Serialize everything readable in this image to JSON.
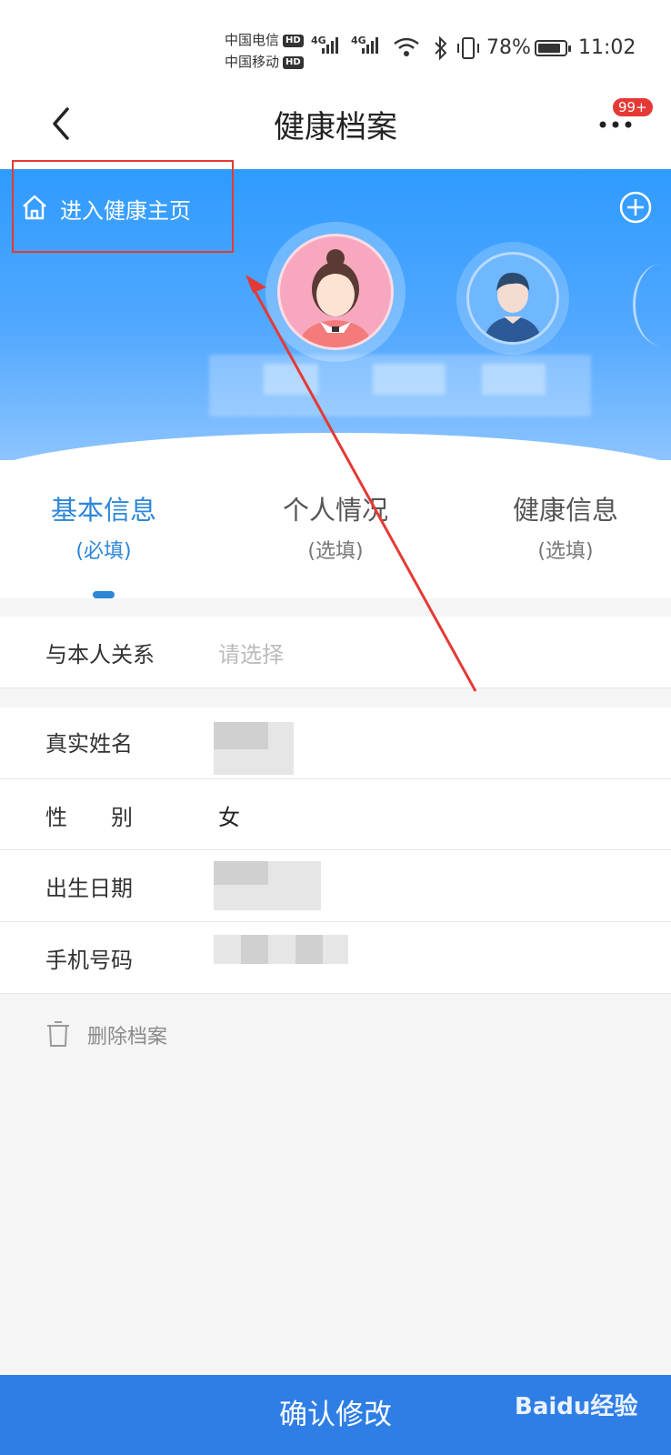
{
  "status_bar": {
    "carrier1": "中国电信",
    "carrier2": "中国移动",
    "hd": "HD",
    "net1": "4G",
    "net2": "4G",
    "battery": "78%",
    "time": "11:02"
  },
  "nav": {
    "title": "健康档案",
    "badge": "99+"
  },
  "banner": {
    "home_label": "进入健康主页"
  },
  "tabs": [
    {
      "label": "基本信息",
      "sub": "(必填)",
      "active": true
    },
    {
      "label": "个人情况",
      "sub": "(选填)",
      "active": false
    },
    {
      "label": "健康信息",
      "sub": "(选填)",
      "active": false
    }
  ],
  "form": {
    "relation_label": "与本人关系",
    "relation_placeholder": "请选择",
    "name_label": "真实姓名",
    "gender_label": "性　　别",
    "gender_value": "女",
    "birth_label": "出生日期",
    "phone_label": "手机号码"
  },
  "delete_label": "删除档案",
  "confirm_label": "确认修改",
  "watermark": "Baidu经验",
  "colors": {
    "accent": "#2d86d8",
    "banner": "#2e9bff",
    "annotation": "#e53935",
    "confirm_bg": "#2e7ee6"
  }
}
